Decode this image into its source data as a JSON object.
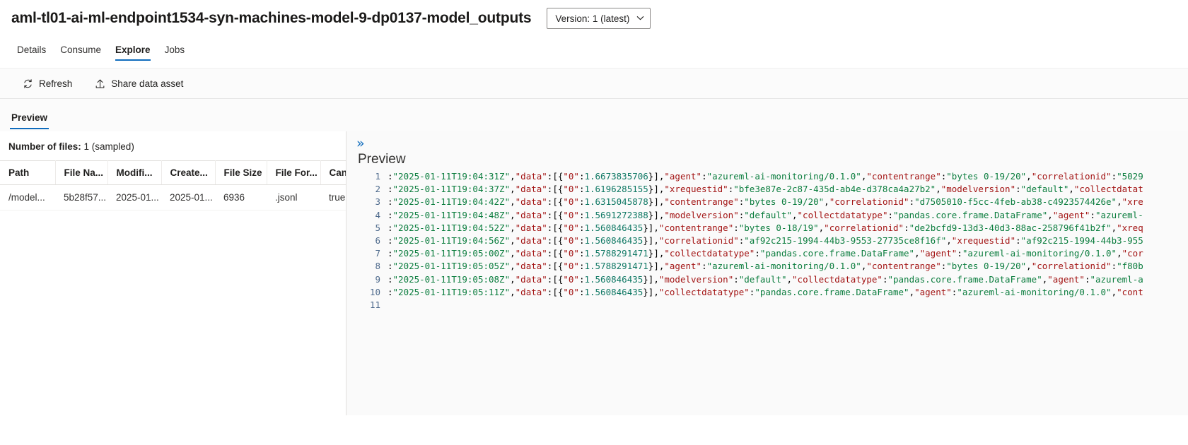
{
  "header": {
    "asset_title": "aml-tl01-ai-ml-endpoint1534-syn-machines-model-9-dp0137-model_outputs",
    "version_label": "Version: 1 (latest)",
    "version_chevron": "chevron-down-icon"
  },
  "tabs": [
    {
      "label": "Details",
      "active": false
    },
    {
      "label": "Consume",
      "active": false
    },
    {
      "label": "Explore",
      "active": true
    },
    {
      "label": "Jobs",
      "active": false
    }
  ],
  "commandbar": {
    "refresh_label": "Refresh",
    "share_label": "Share data asset"
  },
  "subtabs": [
    {
      "label": "Preview",
      "active": true
    }
  ],
  "left": {
    "file_count_label": "Number of files:",
    "file_count_value": "1 (sampled)",
    "columns": [
      "Path",
      "File Na...",
      "Modifi...",
      "Create...",
      "File Size",
      "File For...",
      "CanS"
    ],
    "rows": [
      {
        "path": "/model...",
        "file_name": "5b28f57...",
        "modified": "2025-01...",
        "created": "2025-01...",
        "file_size": "6936",
        "file_format": ".jsonl",
        "cans": "true"
      }
    ]
  },
  "right": {
    "expand_icon": "double-chevron-right-icon",
    "preview_heading": "Preview",
    "line_numbers": [
      "1",
      "2",
      "3",
      "4",
      "5",
      "6",
      "7",
      "8",
      "9",
      "10",
      "11"
    ],
    "lines": [
      {
        "num": "1",
        "segments": [
          {
            "t": ":",
            "c": "p"
          },
          {
            "t": "\"2025-01-11T19:04:31Z\"",
            "c": "s"
          },
          {
            "t": ",",
            "c": "p"
          },
          {
            "t": "\"data\"",
            "c": "k"
          },
          {
            "t": ":[{",
            "c": "p"
          },
          {
            "t": "\"0\"",
            "c": "k"
          },
          {
            "t": ":",
            "c": "p"
          },
          {
            "t": "1.6673835706",
            "c": "n"
          },
          {
            "t": "}],",
            "c": "p"
          },
          {
            "t": "\"agent\"",
            "c": "k"
          },
          {
            "t": ":",
            "c": "p"
          },
          {
            "t": "\"azureml-ai-monitoring/0.1.0\"",
            "c": "s"
          },
          {
            "t": ",",
            "c": "p"
          },
          {
            "t": "\"contentrange\"",
            "c": "k"
          },
          {
            "t": ":",
            "c": "p"
          },
          {
            "t": "\"bytes 0-19/20\"",
            "c": "s"
          },
          {
            "t": ",",
            "c": "p"
          },
          {
            "t": "\"correlationid\"",
            "c": "k"
          },
          {
            "t": ":",
            "c": "p"
          },
          {
            "t": "\"5029",
            "c": "s"
          }
        ]
      },
      {
        "num": "2",
        "segments": [
          {
            "t": ":",
            "c": "p"
          },
          {
            "t": "\"2025-01-11T19:04:37Z\"",
            "c": "s"
          },
          {
            "t": ",",
            "c": "p"
          },
          {
            "t": "\"data\"",
            "c": "k"
          },
          {
            "t": ":[{",
            "c": "p"
          },
          {
            "t": "\"0\"",
            "c": "k"
          },
          {
            "t": ":",
            "c": "p"
          },
          {
            "t": "1.6196285155",
            "c": "n"
          },
          {
            "t": "}],",
            "c": "p"
          },
          {
            "t": "\"xrequestid\"",
            "c": "k"
          },
          {
            "t": ":",
            "c": "p"
          },
          {
            "t": "\"bfe3e87e-2c87-435d-ab4e-d378ca4a27b2\"",
            "c": "s"
          },
          {
            "t": ",",
            "c": "p"
          },
          {
            "t": "\"modelversion\"",
            "c": "k"
          },
          {
            "t": ":",
            "c": "p"
          },
          {
            "t": "\"default\"",
            "c": "s"
          },
          {
            "t": ",",
            "c": "p"
          },
          {
            "t": "\"collectdatat",
            "c": "k"
          }
        ]
      },
      {
        "num": "3",
        "segments": [
          {
            "t": ":",
            "c": "p"
          },
          {
            "t": "\"2025-01-11T19:04:42Z\"",
            "c": "s"
          },
          {
            "t": ",",
            "c": "p"
          },
          {
            "t": "\"data\"",
            "c": "k"
          },
          {
            "t": ":[{",
            "c": "p"
          },
          {
            "t": "\"0\"",
            "c": "k"
          },
          {
            "t": ":",
            "c": "p"
          },
          {
            "t": "1.6315045878",
            "c": "n"
          },
          {
            "t": "}],",
            "c": "p"
          },
          {
            "t": "\"contentrange\"",
            "c": "k"
          },
          {
            "t": ":",
            "c": "p"
          },
          {
            "t": "\"bytes 0-19/20\"",
            "c": "s"
          },
          {
            "t": ",",
            "c": "p"
          },
          {
            "t": "\"correlationid\"",
            "c": "k"
          },
          {
            "t": ":",
            "c": "p"
          },
          {
            "t": "\"d7505010-f5cc-4feb-ab38-c4923574426e\"",
            "c": "s"
          },
          {
            "t": ",",
            "c": "p"
          },
          {
            "t": "\"xre",
            "c": "k"
          }
        ]
      },
      {
        "num": "4",
        "segments": [
          {
            "t": ":",
            "c": "p"
          },
          {
            "t": "\"2025-01-11T19:04:48Z\"",
            "c": "s"
          },
          {
            "t": ",",
            "c": "p"
          },
          {
            "t": "\"data\"",
            "c": "k"
          },
          {
            "t": ":[{",
            "c": "p"
          },
          {
            "t": "\"0\"",
            "c": "k"
          },
          {
            "t": ":",
            "c": "p"
          },
          {
            "t": "1.5691272388",
            "c": "n"
          },
          {
            "t": "}],",
            "c": "p"
          },
          {
            "t": "\"modelversion\"",
            "c": "k"
          },
          {
            "t": ":",
            "c": "p"
          },
          {
            "t": "\"default\"",
            "c": "s"
          },
          {
            "t": ",",
            "c": "p"
          },
          {
            "t": "\"collectdatatype\"",
            "c": "k"
          },
          {
            "t": ":",
            "c": "p"
          },
          {
            "t": "\"pandas.core.frame.DataFrame\"",
            "c": "s"
          },
          {
            "t": ",",
            "c": "p"
          },
          {
            "t": "\"agent\"",
            "c": "k"
          },
          {
            "t": ":",
            "c": "p"
          },
          {
            "t": "\"azureml-",
            "c": "s"
          }
        ]
      },
      {
        "num": "5",
        "segments": [
          {
            "t": ":",
            "c": "p"
          },
          {
            "t": "\"2025-01-11T19:04:52Z\"",
            "c": "s"
          },
          {
            "t": ",",
            "c": "p"
          },
          {
            "t": "\"data\"",
            "c": "k"
          },
          {
            "t": ":[{",
            "c": "p"
          },
          {
            "t": "\"0\"",
            "c": "k"
          },
          {
            "t": ":",
            "c": "p"
          },
          {
            "t": "1.560846435",
            "c": "n"
          },
          {
            "t": "}],",
            "c": "p"
          },
          {
            "t": "\"contentrange\"",
            "c": "k"
          },
          {
            "t": ":",
            "c": "p"
          },
          {
            "t": "\"bytes 0-18/19\"",
            "c": "s"
          },
          {
            "t": ",",
            "c": "p"
          },
          {
            "t": "\"correlationid\"",
            "c": "k"
          },
          {
            "t": ":",
            "c": "p"
          },
          {
            "t": "\"de2bcfd9-13d3-40d3-88ac-258796f41b2f\"",
            "c": "s"
          },
          {
            "t": ",",
            "c": "p"
          },
          {
            "t": "\"xreq",
            "c": "k"
          }
        ]
      },
      {
        "num": "6",
        "segments": [
          {
            "t": ":",
            "c": "p"
          },
          {
            "t": "\"2025-01-11T19:04:56Z\"",
            "c": "s"
          },
          {
            "t": ",",
            "c": "p"
          },
          {
            "t": "\"data\"",
            "c": "k"
          },
          {
            "t": ":[{",
            "c": "p"
          },
          {
            "t": "\"0\"",
            "c": "k"
          },
          {
            "t": ":",
            "c": "p"
          },
          {
            "t": "1.560846435",
            "c": "n"
          },
          {
            "t": "}],",
            "c": "p"
          },
          {
            "t": "\"correlationid\"",
            "c": "k"
          },
          {
            "t": ":",
            "c": "p"
          },
          {
            "t": "\"af92c215-1994-44b3-9553-27735ce8f16f\"",
            "c": "s"
          },
          {
            "t": ",",
            "c": "p"
          },
          {
            "t": "\"xrequestid\"",
            "c": "k"
          },
          {
            "t": ":",
            "c": "p"
          },
          {
            "t": "\"af92c215-1994-44b3-955",
            "c": "s"
          }
        ]
      },
      {
        "num": "7",
        "segments": [
          {
            "t": ":",
            "c": "p"
          },
          {
            "t": "\"2025-01-11T19:05:00Z\"",
            "c": "s"
          },
          {
            "t": ",",
            "c": "p"
          },
          {
            "t": "\"data\"",
            "c": "k"
          },
          {
            "t": ":[{",
            "c": "p"
          },
          {
            "t": "\"0\"",
            "c": "k"
          },
          {
            "t": ":",
            "c": "p"
          },
          {
            "t": "1.5788291471",
            "c": "n"
          },
          {
            "t": "}],",
            "c": "p"
          },
          {
            "t": "\"collectdatatype\"",
            "c": "k"
          },
          {
            "t": ":",
            "c": "p"
          },
          {
            "t": "\"pandas.core.frame.DataFrame\"",
            "c": "s"
          },
          {
            "t": ",",
            "c": "p"
          },
          {
            "t": "\"agent\"",
            "c": "k"
          },
          {
            "t": ":",
            "c": "p"
          },
          {
            "t": "\"azureml-ai-monitoring/0.1.0\"",
            "c": "s"
          },
          {
            "t": ",",
            "c": "p"
          },
          {
            "t": "\"cor",
            "c": "k"
          }
        ]
      },
      {
        "num": "8",
        "segments": [
          {
            "t": ":",
            "c": "p"
          },
          {
            "t": "\"2025-01-11T19:05:05Z\"",
            "c": "s"
          },
          {
            "t": ",",
            "c": "p"
          },
          {
            "t": "\"data\"",
            "c": "k"
          },
          {
            "t": ":[{",
            "c": "p"
          },
          {
            "t": "\"0\"",
            "c": "k"
          },
          {
            "t": ":",
            "c": "p"
          },
          {
            "t": "1.5788291471",
            "c": "n"
          },
          {
            "t": "}],",
            "c": "p"
          },
          {
            "t": "\"agent\"",
            "c": "k"
          },
          {
            "t": ":",
            "c": "p"
          },
          {
            "t": "\"azureml-ai-monitoring/0.1.0\"",
            "c": "s"
          },
          {
            "t": ",",
            "c": "p"
          },
          {
            "t": "\"contentrange\"",
            "c": "k"
          },
          {
            "t": ":",
            "c": "p"
          },
          {
            "t": "\"bytes 0-19/20\"",
            "c": "s"
          },
          {
            "t": ",",
            "c": "p"
          },
          {
            "t": "\"correlationid\"",
            "c": "k"
          },
          {
            "t": ":",
            "c": "p"
          },
          {
            "t": "\"f80b",
            "c": "s"
          }
        ]
      },
      {
        "num": "9",
        "segments": [
          {
            "t": ":",
            "c": "p"
          },
          {
            "t": "\"2025-01-11T19:05:08Z\"",
            "c": "s"
          },
          {
            "t": ",",
            "c": "p"
          },
          {
            "t": "\"data\"",
            "c": "k"
          },
          {
            "t": ":[{",
            "c": "p"
          },
          {
            "t": "\"0\"",
            "c": "k"
          },
          {
            "t": ":",
            "c": "p"
          },
          {
            "t": "1.560846435",
            "c": "n"
          },
          {
            "t": "}],",
            "c": "p"
          },
          {
            "t": "\"modelversion\"",
            "c": "k"
          },
          {
            "t": ":",
            "c": "p"
          },
          {
            "t": "\"default\"",
            "c": "s"
          },
          {
            "t": ",",
            "c": "p"
          },
          {
            "t": "\"collectdatatype\"",
            "c": "k"
          },
          {
            "t": ":",
            "c": "p"
          },
          {
            "t": "\"pandas.core.frame.DataFrame\"",
            "c": "s"
          },
          {
            "t": ",",
            "c": "p"
          },
          {
            "t": "\"agent\"",
            "c": "k"
          },
          {
            "t": ":",
            "c": "p"
          },
          {
            "t": "\"azureml-a",
            "c": "s"
          }
        ]
      },
      {
        "num": "10",
        "segments": [
          {
            "t": ":",
            "c": "p"
          },
          {
            "t": "\"2025-01-11T19:05:11Z\"",
            "c": "s"
          },
          {
            "t": ",",
            "c": "p"
          },
          {
            "t": "\"data\"",
            "c": "k"
          },
          {
            "t": ":[{",
            "c": "p"
          },
          {
            "t": "\"0\"",
            "c": "k"
          },
          {
            "t": ":",
            "c": "p"
          },
          {
            "t": "1.560846435",
            "c": "n"
          },
          {
            "t": "}],",
            "c": "p"
          },
          {
            "t": "\"collectdatatype\"",
            "c": "k"
          },
          {
            "t": ":",
            "c": "p"
          },
          {
            "t": "\"pandas.core.frame.DataFrame\"",
            "c": "s"
          },
          {
            "t": ",",
            "c": "p"
          },
          {
            "t": "\"agent\"",
            "c": "k"
          },
          {
            "t": ":",
            "c": "p"
          },
          {
            "t": "\"azureml-ai-monitoring/0.1.0\"",
            "c": "s"
          },
          {
            "t": ",",
            "c": "p"
          },
          {
            "t": "\"cont",
            "c": "k"
          }
        ]
      },
      {
        "num": "11",
        "segments": []
      }
    ]
  }
}
